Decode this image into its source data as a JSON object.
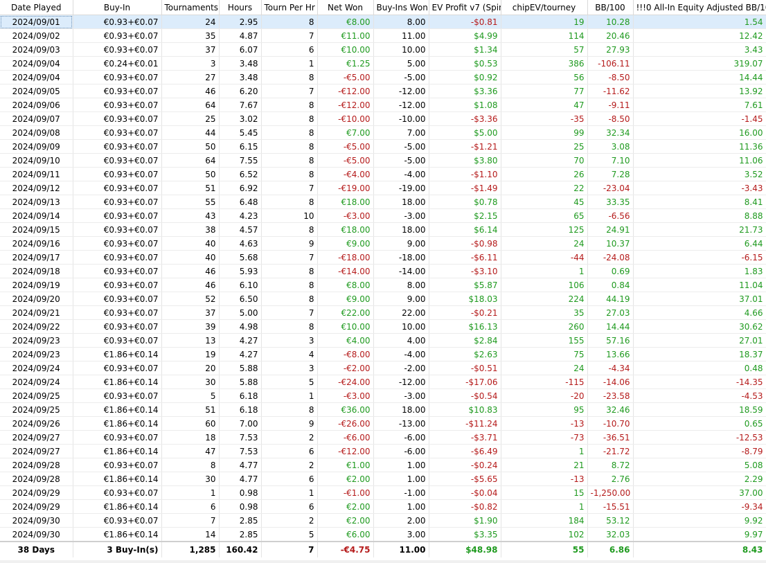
{
  "columns": [
    "Date Played",
    "Buy-In",
    "Tournaments",
    "Hours",
    "Tourn Per Hr",
    "Net Won",
    "Buy-Ins Won",
    "EV Profit v7 (Spin)",
    "chipEV/tourney",
    "BB/100",
    "!!!0 All-In Equity Adjusted BB/100"
  ],
  "rows": [
    [
      "2024/09/01",
      "€0.93+€0.07",
      "24",
      "2.95",
      "8",
      "€8.00",
      "8.00",
      "-$0.81",
      "19",
      "10.28",
      "1.54"
    ],
    [
      "2024/09/02",
      "€0.93+€0.07",
      "35",
      "4.87",
      "7",
      "€11.00",
      "11.00",
      "$4.99",
      "114",
      "20.46",
      "12.42"
    ],
    [
      "2024/09/03",
      "€0.93+€0.07",
      "37",
      "6.07",
      "6",
      "€10.00",
      "10.00",
      "$1.34",
      "57",
      "27.93",
      "3.43"
    ],
    [
      "2024/09/04",
      "€0.24+€0.01",
      "3",
      "3.48",
      "1",
      "€1.25",
      "5.00",
      "$0.53",
      "386",
      "-106.11",
      "319.07"
    ],
    [
      "2024/09/04",
      "€0.93+€0.07",
      "27",
      "3.48",
      "8",
      "-€5.00",
      "-5.00",
      "$0.92",
      "56",
      "-8.50",
      "14.44"
    ],
    [
      "2024/09/05",
      "€0.93+€0.07",
      "46",
      "6.20",
      "7",
      "-€12.00",
      "-12.00",
      "$3.36",
      "77",
      "-11.62",
      "13.92"
    ],
    [
      "2024/09/06",
      "€0.93+€0.07",
      "64",
      "7.67",
      "8",
      "-€12.00",
      "-12.00",
      "$1.08",
      "47",
      "-9.11",
      "7.61"
    ],
    [
      "2024/09/07",
      "€0.93+€0.07",
      "25",
      "3.02",
      "8",
      "-€10.00",
      "-10.00",
      "-$3.36",
      "-35",
      "-8.50",
      "-1.45"
    ],
    [
      "2024/09/08",
      "€0.93+€0.07",
      "44",
      "5.45",
      "8",
      "€7.00",
      "7.00",
      "$5.00",
      "99",
      "32.34",
      "16.00"
    ],
    [
      "2024/09/09",
      "€0.93+€0.07",
      "50",
      "6.15",
      "8",
      "-€5.00",
      "-5.00",
      "-$1.21",
      "25",
      "3.08",
      "11.36"
    ],
    [
      "2024/09/10",
      "€0.93+€0.07",
      "64",
      "7.55",
      "8",
      "-€5.00",
      "-5.00",
      "$3.80",
      "70",
      "7.10",
      "11.06"
    ],
    [
      "2024/09/11",
      "€0.93+€0.07",
      "50",
      "6.52",
      "8",
      "-€4.00",
      "-4.00",
      "-$1.10",
      "26",
      "7.28",
      "3.52"
    ],
    [
      "2024/09/12",
      "€0.93+€0.07",
      "51",
      "6.92",
      "7",
      "-€19.00",
      "-19.00",
      "-$1.49",
      "22",
      "-23.04",
      "-3.43"
    ],
    [
      "2024/09/13",
      "€0.93+€0.07",
      "55",
      "6.48",
      "8",
      "€18.00",
      "18.00",
      "$0.78",
      "45",
      "33.35",
      "8.41"
    ],
    [
      "2024/09/14",
      "€0.93+€0.07",
      "43",
      "4.23",
      "10",
      "-€3.00",
      "-3.00",
      "$2.15",
      "65",
      "-6.56",
      "8.88"
    ],
    [
      "2024/09/15",
      "€0.93+€0.07",
      "38",
      "4.57",
      "8",
      "€18.00",
      "18.00",
      "$6.14",
      "125",
      "24.91",
      "21.73"
    ],
    [
      "2024/09/16",
      "€0.93+€0.07",
      "40",
      "4.63",
      "9",
      "€9.00",
      "9.00",
      "-$0.98",
      "24",
      "10.37",
      "6.44"
    ],
    [
      "2024/09/17",
      "€0.93+€0.07",
      "40",
      "5.68",
      "7",
      "-€18.00",
      "-18.00",
      "-$6.11",
      "-44",
      "-24.08",
      "-6.15"
    ],
    [
      "2024/09/18",
      "€0.93+€0.07",
      "46",
      "5.93",
      "8",
      "-€14.00",
      "-14.00",
      "-$3.10",
      "1",
      "0.69",
      "1.83"
    ],
    [
      "2024/09/19",
      "€0.93+€0.07",
      "46",
      "6.10",
      "8",
      "€8.00",
      "8.00",
      "$5.87",
      "106",
      "0.84",
      "11.04"
    ],
    [
      "2024/09/20",
      "€0.93+€0.07",
      "52",
      "6.50",
      "8",
      "€9.00",
      "9.00",
      "$18.03",
      "224",
      "44.19",
      "37.01"
    ],
    [
      "2024/09/21",
      "€0.93+€0.07",
      "37",
      "5.00",
      "7",
      "€22.00",
      "22.00",
      "-$0.21",
      "35",
      "27.03",
      "4.66"
    ],
    [
      "2024/09/22",
      "€0.93+€0.07",
      "39",
      "4.98",
      "8",
      "€10.00",
      "10.00",
      "$16.13",
      "260",
      "14.44",
      "30.62"
    ],
    [
      "2024/09/23",
      "€0.93+€0.07",
      "13",
      "4.27",
      "3",
      "€4.00",
      "4.00",
      "$2.84",
      "155",
      "57.16",
      "27.01"
    ],
    [
      "2024/09/23",
      "€1.86+€0.14",
      "19",
      "4.27",
      "4",
      "-€8.00",
      "-4.00",
      "$2.63",
      "75",
      "13.66",
      "18.37"
    ],
    [
      "2024/09/24",
      "€0.93+€0.07",
      "20",
      "5.88",
      "3",
      "-€2.00",
      "-2.00",
      "-$0.51",
      "24",
      "-4.34",
      "0.48"
    ],
    [
      "2024/09/24",
      "€1.86+€0.14",
      "30",
      "5.88",
      "5",
      "-€24.00",
      "-12.00",
      "-$17.06",
      "-115",
      "-14.06",
      "-14.35"
    ],
    [
      "2024/09/25",
      "€0.93+€0.07",
      "5",
      "6.18",
      "1",
      "-€3.00",
      "-3.00",
      "-$0.54",
      "-20",
      "-23.58",
      "-4.53"
    ],
    [
      "2024/09/25",
      "€1.86+€0.14",
      "51",
      "6.18",
      "8",
      "€36.00",
      "18.00",
      "$10.83",
      "95",
      "32.46",
      "18.59"
    ],
    [
      "2024/09/26",
      "€1.86+€0.14",
      "60",
      "7.00",
      "9",
      "-€26.00",
      "-13.00",
      "-$11.24",
      "-13",
      "-10.70",
      "0.65"
    ],
    [
      "2024/09/27",
      "€0.93+€0.07",
      "18",
      "7.53",
      "2",
      "-€6.00",
      "-6.00",
      "-$3.71",
      "-73",
      "-36.51",
      "-12.53"
    ],
    [
      "2024/09/27",
      "€1.86+€0.14",
      "47",
      "7.53",
      "6",
      "-€12.00",
      "-6.00",
      "-$6.49",
      "1",
      "-21.72",
      "-8.79"
    ],
    [
      "2024/09/28",
      "€0.93+€0.07",
      "8",
      "4.77",
      "2",
      "€1.00",
      "1.00",
      "-$0.24",
      "21",
      "8.72",
      "5.08"
    ],
    [
      "2024/09/28",
      "€1.86+€0.14",
      "30",
      "4.77",
      "6",
      "€2.00",
      "1.00",
      "-$5.65",
      "-13",
      "2.76",
      "2.29"
    ],
    [
      "2024/09/29",
      "€0.93+€0.07",
      "1",
      "0.98",
      "1",
      "-€1.00",
      "-1.00",
      "-$0.04",
      "15",
      "-1,250.00",
      "37.00"
    ],
    [
      "2024/09/29",
      "€1.86+€0.14",
      "6",
      "0.98",
      "6",
      "€2.00",
      "1.00",
      "-$0.82",
      "1",
      "-15.51",
      "-9.34"
    ],
    [
      "2024/09/30",
      "€0.93+€0.07",
      "7",
      "2.85",
      "2",
      "€2.00",
      "2.00",
      "$1.90",
      "184",
      "53.12",
      "9.92"
    ],
    [
      "2024/09/30",
      "€1.86+€0.14",
      "14",
      "2.85",
      "5",
      "€6.00",
      "3.00",
      "$3.35",
      "102",
      "32.03",
      "9.97"
    ]
  ],
  "totals": [
    "38 Days",
    "3 Buy-In(s)",
    "1,285",
    "160.42",
    "7",
    "-€4.75",
    "11.00",
    "$48.98",
    "55",
    "6.86",
    "8.43"
  ],
  "colors": {
    "positive": "#1f9a1f",
    "negative": "#b51b1b",
    "selected_row": "#dcecfb"
  }
}
